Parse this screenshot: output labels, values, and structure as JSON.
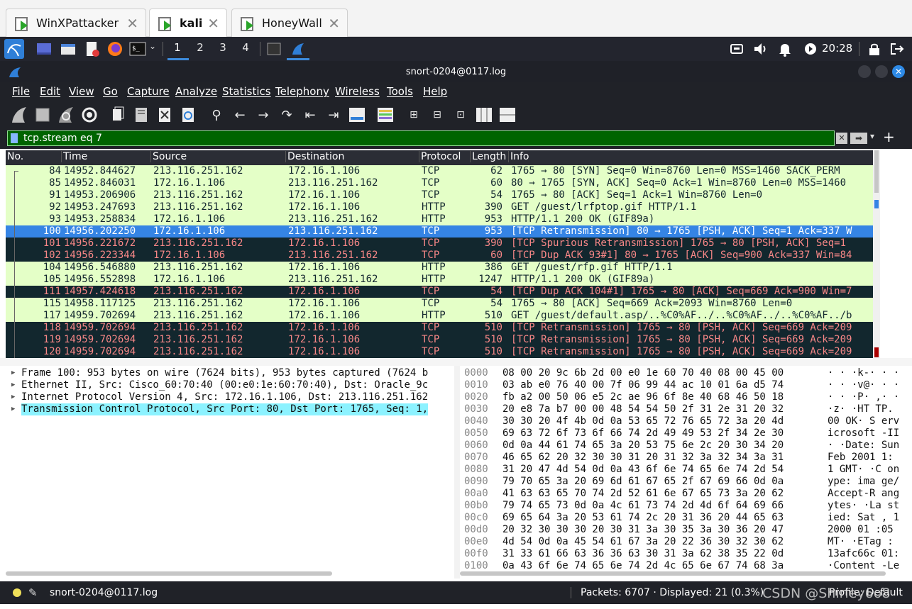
{
  "vm_tabs": [
    {
      "label": "WinXPattacker",
      "active": false
    },
    {
      "label": "kali",
      "active": true
    },
    {
      "label": "HoneyWall",
      "active": false
    }
  ],
  "panel": {
    "workspaces": [
      "1",
      "2",
      "3",
      "4"
    ],
    "clock": "20:28"
  },
  "window": {
    "title": "snort-0204@0117.log"
  },
  "menu": [
    "File",
    "Edit",
    "View",
    "Go",
    "Capture",
    "Analyze",
    "Statistics",
    "Telephony",
    "Wireless",
    "Tools",
    "Help"
  ],
  "filter": {
    "value": "tcp.stream eq 7",
    "add_label": "+"
  },
  "packet_list": {
    "columns": [
      "No.",
      "Time",
      "Source",
      "Destination",
      "Protocol",
      "Length",
      "Info"
    ],
    "rows": [
      {
        "no": "84",
        "time": "14952.844627",
        "src": "213.116.251.162",
        "dst": "172.16.1.106",
        "proto": "TCP",
        "len": "62",
        "info": "1765 → 80 [SYN] Seq=0 Win=8760 Len=0 MSS=1460 SACK_PERM",
        "style": "green"
      },
      {
        "no": "85",
        "time": "14952.846031",
        "src": "172.16.1.106",
        "dst": "213.116.251.162",
        "proto": "TCP",
        "len": "60",
        "info": "80 → 1765 [SYN, ACK] Seq=0 Ack=1 Win=8760 Len=0 MSS=1460",
        "style": "green"
      },
      {
        "no": "91",
        "time": "14953.206906",
        "src": "213.116.251.162",
        "dst": "172.16.1.106",
        "proto": "TCP",
        "len": "54",
        "info": "1765 → 80 [ACK] Seq=1 Ack=1 Win=8760 Len=0",
        "style": "green"
      },
      {
        "no": "92",
        "time": "14953.247693",
        "src": "213.116.251.162",
        "dst": "172.16.1.106",
        "proto": "HTTP",
        "len": "390",
        "info": "GET /guest/lrfptop.gif HTTP/1.1",
        "style": "green"
      },
      {
        "no": "93",
        "time": "14953.258834",
        "src": "172.16.1.106",
        "dst": "213.116.251.162",
        "proto": "HTTP",
        "len": "953",
        "info": "HTTP/1.1 200 OK  (GIF89a)",
        "style": "green"
      },
      {
        "no": "100",
        "time": "14956.202250",
        "src": "172.16.1.106",
        "dst": "213.116.251.162",
        "proto": "TCP",
        "len": "953",
        "info": "[TCP Retransmission] 80 → 1765 [PSH, ACK] Seq=1 Ack=337 W",
        "style": "sel"
      },
      {
        "no": "101",
        "time": "14956.221672",
        "src": "213.116.251.162",
        "dst": "172.16.1.106",
        "proto": "TCP",
        "len": "390",
        "info": "[TCP Spurious Retransmission] 1765 → 80 [PSH, ACK] Seq=1",
        "style": "dark"
      },
      {
        "no": "102",
        "time": "14956.223344",
        "src": "172.16.1.106",
        "dst": "213.116.251.162",
        "proto": "TCP",
        "len": "60",
        "info": "[TCP Dup ACK 93#1] 80 → 1765 [ACK] Seq=900 Ack=337 Win=84",
        "style": "dark"
      },
      {
        "no": "104",
        "time": "14956.546880",
        "src": "213.116.251.162",
        "dst": "172.16.1.106",
        "proto": "HTTP",
        "len": "386",
        "info": "GET /guest/rfp.gif HTTP/1.1",
        "style": "green"
      },
      {
        "no": "105",
        "time": "14956.552898",
        "src": "172.16.1.106",
        "dst": "213.116.251.162",
        "proto": "HTTP",
        "len": "1247",
        "info": "HTTP/1.1 200 OK  (GIF89a)",
        "style": "green"
      },
      {
        "no": "111",
        "time": "14957.424618",
        "src": "213.116.251.162",
        "dst": "172.16.1.106",
        "proto": "TCP",
        "len": "54",
        "info": "[TCP Dup ACK 104#1] 1765 → 80 [ACK] Seq=669 Ack=900 Win=7",
        "style": "dark"
      },
      {
        "no": "115",
        "time": "14958.117125",
        "src": "213.116.251.162",
        "dst": "172.16.1.106",
        "proto": "TCP",
        "len": "54",
        "info": "1765 → 80 [ACK] Seq=669 Ack=2093 Win=8760 Len=0",
        "style": "green"
      },
      {
        "no": "117",
        "time": "14959.702694",
        "src": "213.116.251.162",
        "dst": "172.16.1.106",
        "proto": "HTTP",
        "len": "510",
        "info": "GET /guest/default.asp/..%C0%AF../..%C0%AF../..%C0%AF../b",
        "style": "green"
      },
      {
        "no": "118",
        "time": "14959.702694",
        "src": "213.116.251.162",
        "dst": "172.16.1.106",
        "proto": "TCP",
        "len": "510",
        "info": "[TCP Retransmission] 1765 → 80 [PSH, ACK] Seq=669 Ack=209",
        "style": "dark"
      },
      {
        "no": "119",
        "time": "14959.702694",
        "src": "213.116.251.162",
        "dst": "172.16.1.106",
        "proto": "TCP",
        "len": "510",
        "info": "[TCP Retransmission] 1765 → 80 [PSH, ACK] Seq=669 Ack=209",
        "style": "dark"
      },
      {
        "no": "120",
        "time": "14959.702694",
        "src": "213.116.251.162",
        "dst": "172.16.1.106",
        "proto": "TCP",
        "len": "510",
        "info": "[TCP Retransmission] 1765 → 80 [PSH, ACK] Seq=669 Ack=209",
        "style": "dark"
      }
    ]
  },
  "details": [
    {
      "text": "Frame 100: 953 bytes on wire (7624 bits), 953 bytes captured (7624 b",
      "selected": false
    },
    {
      "text": "Ethernet II, Src: Cisco_60:70:40 (00:e0:1e:60:70:40), Dst: Oracle_9c",
      "selected": false
    },
    {
      "text": "Internet Protocol Version 4, Src: 172.16.1.106, Dst: 213.116.251.162",
      "selected": false
    },
    {
      "text": "Transmission Control Protocol, Src Port: 80, Dst Port: 1765, Seq: 1,",
      "selected": true
    }
  ],
  "bytes": [
    {
      "off": "0000",
      "hex": "08 00 20 9c 6b 2d 00 e0  1e 60 70 40 08 00 45 00",
      "ascii": "· · ·k-· · · `"
    },
    {
      "off": "0010",
      "hex": "03 ab e0 76 40 00 7f 06  99 44 ac 10 01 6a d5 74",
      "ascii": "· · ·v@· · ·  D"
    },
    {
      "off": "0020",
      "hex": "fb a2 00 50 06 e5 2c ae  96 6f 8e 40 68 46 50 18",
      "ascii": "· · ·P· ,· ·  o"
    },
    {
      "off": "0030",
      "hex": "20 e8 7a b7 00 00 48 54  54 50 2f 31 2e 31 20 32",
      "ascii": " ·z· ·HT TP."
    },
    {
      "off": "0040",
      "hex": "30 30 20 4f 4b 0d 0a 53  65 72 76 65 72 3a 20 4d",
      "ascii": "00 OK· S erv"
    },
    {
      "off": "0050",
      "hex": "69 63 72 6f 73 6f 66 74  2d 49 49 53 2f 34 2e 30",
      "ascii": "icrosoft -II"
    },
    {
      "off": "0060",
      "hex": "0d 0a 44 61 74 65 3a 20  53 75 6e 2c 20 30 34 20",
      "ascii": "· ·Date:  Sun"
    },
    {
      "off": "0070",
      "hex": "46 65 62 20 32 30 30 31  20 31 32 3a 32 34 3a 31",
      "ascii": "Feb 2001  1:"
    },
    {
      "off": "0080",
      "hex": "31 20 47 4d 54 0d 0a 43  6f 6e 74 65 6e 74 2d 54",
      "ascii": "1 GMT· ·C ont"
    },
    {
      "off": "0090",
      "hex": "79 70 65 3a 20 69 6d 61  67 65 2f 67 69 66 0d 0a",
      "ascii": "ype: ima ge/"
    },
    {
      "off": "00a0",
      "hex": "41 63 63 65 70 74 2d 52  61 6e 67 65 73 3a 20 62",
      "ascii": "Accept-R ang"
    },
    {
      "off": "00b0",
      "hex": "79 74 65 73 0d 0a 4c 61  73 74 2d 4d 6f 64 69 66",
      "ascii": "ytes· ·La st"
    },
    {
      "off": "00c0",
      "hex": "69 65 64 3a 20 53 61 74  2c 20 31 36 20 44 65 63",
      "ascii": "ied: Sat , 1"
    },
    {
      "off": "00d0",
      "hex": "20 32 30 30 30 20 30 31  3a 30 35 3a 30 36 20 47",
      "ascii": " 2000 01 :05"
    },
    {
      "off": "00e0",
      "hex": "4d 54 0d 0a 45 54 61 67  3a 20 22 36 30 32 30 62",
      "ascii": "MT· ·ETag  : \""
    },
    {
      "off": "00f0",
      "hex": "31 33 61 66 63 36 36 63  30 31 3a 62 38 35 22 0d",
      "ascii": "13afc66c 01:"
    },
    {
      "off": "0100",
      "hex": "0a 43 6f 6e 74 65 6e 74  2d 4c 65 6e 67 74 68 3a",
      "ascii": "·Content -Le"
    }
  ],
  "status": {
    "file": "snort-0204@0117.log",
    "packets": "Packets: 6707 · Displayed: 21 (0.3%)",
    "profile": "Profile: Default"
  },
  "watermark": "CSDN @Shirley6o8",
  "colors": {
    "green_row": "#e4ffc7",
    "dark_row": "#12272e",
    "dark_row_text": "#f78787",
    "selected_row": "#3584e4",
    "filter_valid": "#006400"
  }
}
